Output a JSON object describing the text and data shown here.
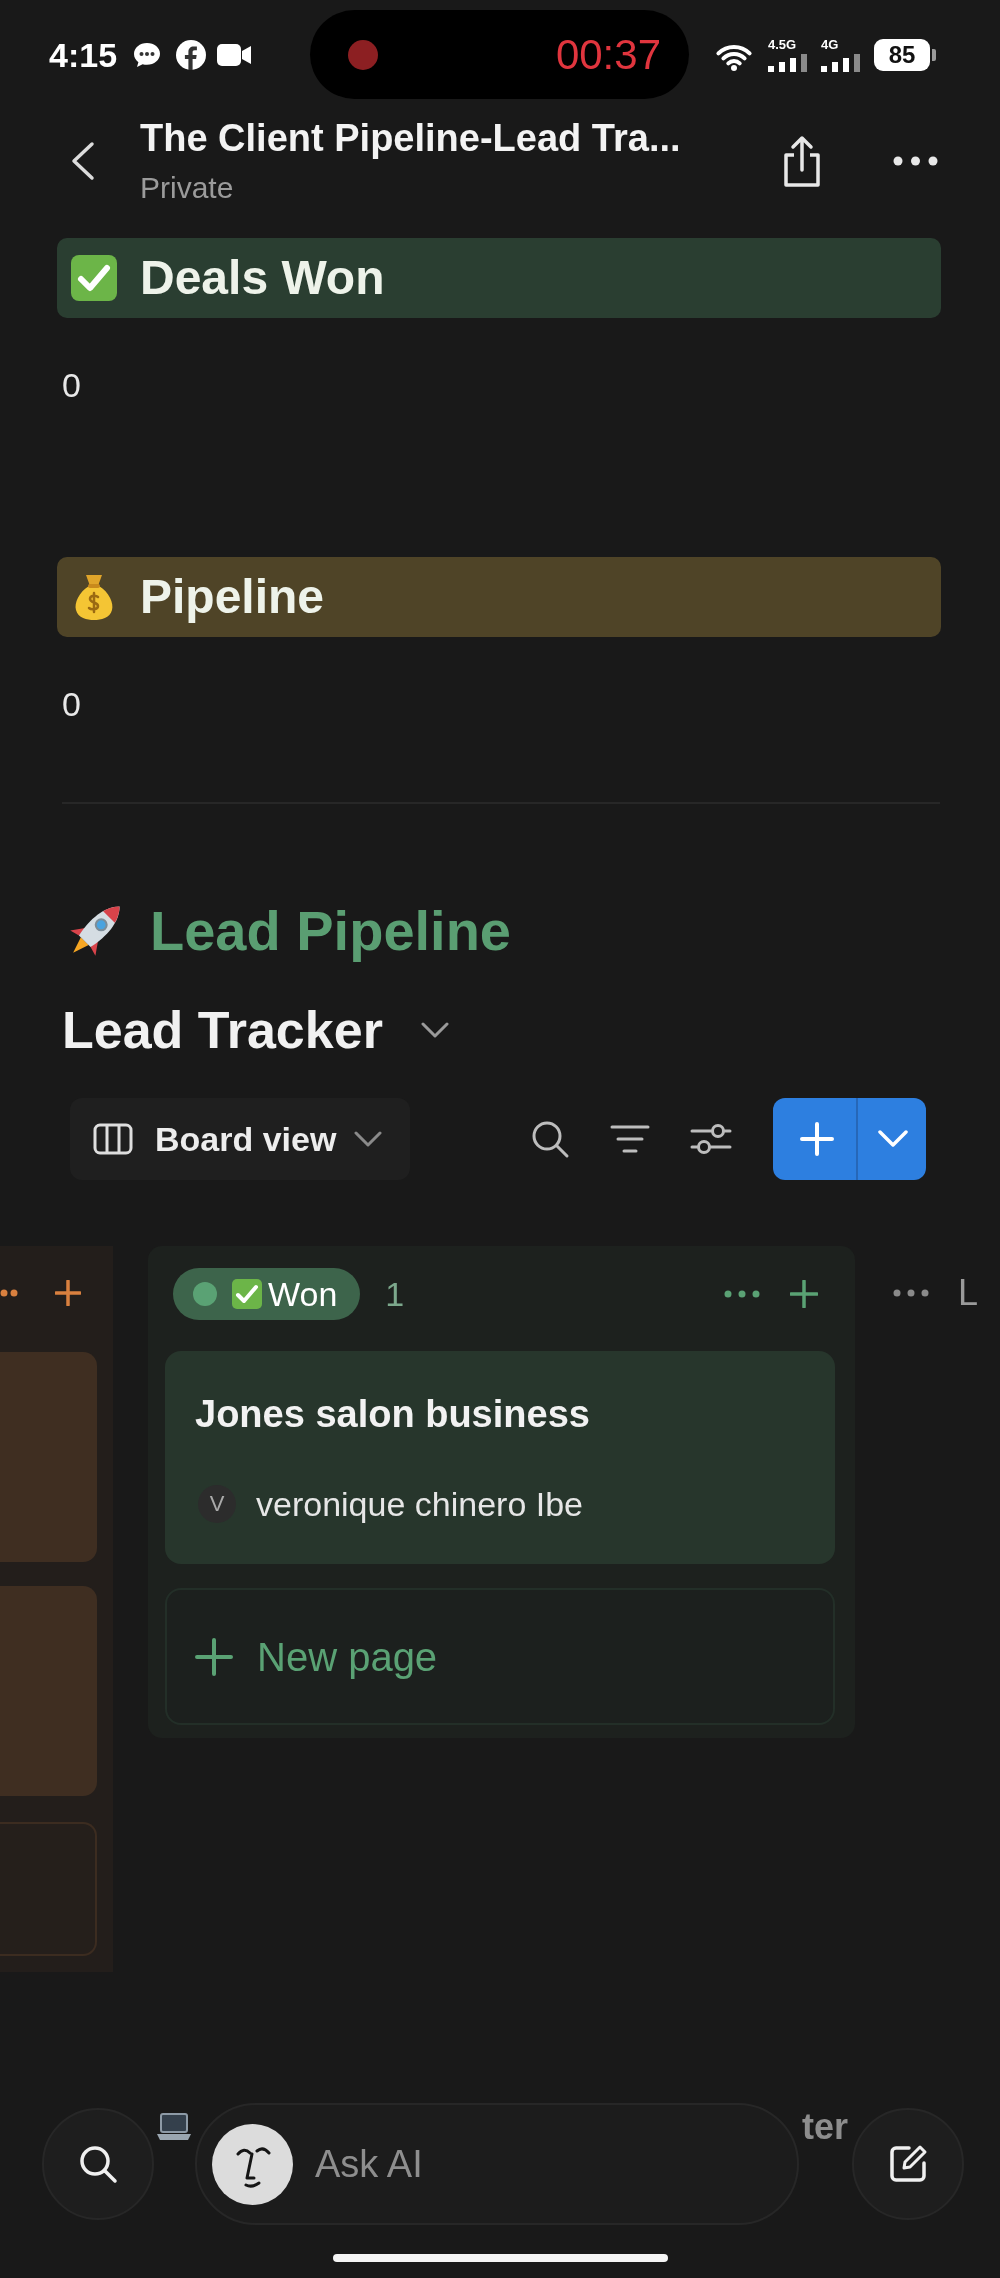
{
  "status_bar": {
    "time": "4:15",
    "recording_timer": "00:37",
    "networks": [
      {
        "label": "4.5G"
      },
      {
        "label": "4G"
      }
    ],
    "battery": "85"
  },
  "header": {
    "title": "The Client Pipeline-Lead Tra...",
    "subtitle": "Private"
  },
  "callouts": [
    {
      "kind": "check",
      "title": "Deals Won",
      "value": "0",
      "color": "#2a3e31"
    },
    {
      "kind": "money",
      "title": "Pipeline",
      "value": "0",
      "color": "#4f4427"
    }
  ],
  "section": {
    "heading": "Lead Pipeline",
    "database": {
      "title": "Lead Tracker",
      "view": {
        "label": "Board view"
      }
    }
  },
  "board": {
    "columns": [
      {
        "kind": "cut_left",
        "color": "#d9803f",
        "cards": [
          {
            "kind": "page"
          },
          {
            "kind": "page"
          },
          {
            "kind": "add"
          }
        ]
      },
      {
        "kind": "full",
        "label": "Won",
        "count": "1",
        "color": "#5aa274",
        "cards": [
          {
            "kind": "page",
            "title": "Jones salon business",
            "assignee": {
              "initial": "V",
              "name": "veronique chinero Ibe"
            }
          },
          {
            "kind": "add",
            "label": "New page"
          }
        ]
      },
      {
        "kind": "cut_right",
        "label": "L"
      }
    ]
  },
  "next_section": {
    "heading_fragment": "ter"
  },
  "ask_ai": {
    "placeholder": "Ask AI"
  }
}
